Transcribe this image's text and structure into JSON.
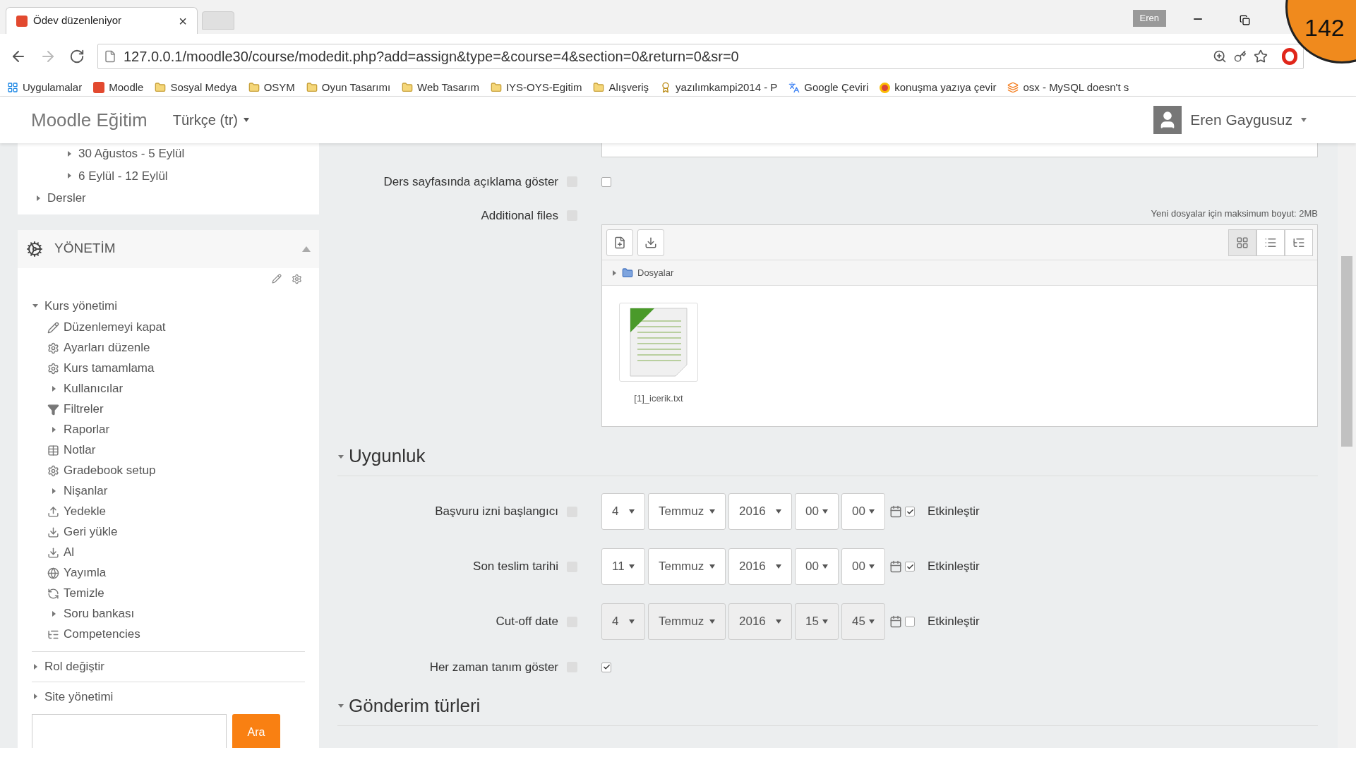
{
  "browser": {
    "tab": {
      "title": "Ödev düzenleniyor",
      "close": "×"
    },
    "profile": "Eren",
    "badge": "142",
    "url": "127.0.0.1/moodle30/course/modedit.php?add=assign&type=&course=4&section=0&return=0&sr=0",
    "bookmarks": [
      {
        "label": "Uygulamalar",
        "kind": "apps"
      },
      {
        "label": "Moodle",
        "kind": "moodle"
      },
      {
        "label": "Sosyal Medya",
        "kind": "folder"
      },
      {
        "label": "OSYM",
        "kind": "folder"
      },
      {
        "label": "Oyun Tasarımı",
        "kind": "folder"
      },
      {
        "label": "Web Tasarım",
        "kind": "folder"
      },
      {
        "label": "IYS-OYS-Egitim",
        "kind": "folder"
      },
      {
        "label": "Alışveriş",
        "kind": "folder"
      },
      {
        "label": "yazılımkampi2014 - P",
        "kind": "badge"
      },
      {
        "label": "Google Çeviri",
        "kind": "translate"
      },
      {
        "label": "konuşma yazıya çevir",
        "kind": "circle"
      },
      {
        "label": "osx - MySQL doesn't s",
        "kind": "stack"
      }
    ]
  },
  "header": {
    "site_name": "Moodle Eğitim",
    "language": "Türkçe (tr)",
    "user": "Eren Gaygusuz"
  },
  "sidebar": {
    "courses": [
      {
        "label": "30 Ağustos - 5 Eylül",
        "expanded": false
      },
      {
        "label": "6 Eylül - 12 Eylül",
        "expanded": false
      }
    ],
    "courses_root": {
      "label": "Dersler",
      "expanded": false
    },
    "admin": {
      "title": "YÖNETİM",
      "tree": [
        {
          "label": "Kurs yönetimi",
          "expanded": true,
          "children": [
            {
              "label": "Düzenlemeyi kapat",
              "kind": "pencil"
            },
            {
              "label": "Ayarları düzenle",
              "kind": "gear"
            },
            {
              "label": "Kurs tamamlama",
              "kind": "gear"
            },
            {
              "label": "Kullanıcılar",
              "kind": "branch"
            },
            {
              "label": "Filtreler",
              "kind": "filter"
            },
            {
              "label": "Raporlar",
              "kind": "branch"
            },
            {
              "label": "Notlar",
              "kind": "table"
            },
            {
              "label": "Gradebook setup",
              "kind": "gear"
            },
            {
              "label": "Nişanlar",
              "kind": "branch"
            },
            {
              "label": "Yedekle",
              "kind": "upload"
            },
            {
              "label": "Geri yükle",
              "kind": "download"
            },
            {
              "label": "Al",
              "kind": "download"
            },
            {
              "label": "Yayımla",
              "kind": "globe"
            },
            {
              "label": "Temizle",
              "kind": "refresh"
            },
            {
              "label": "Soru bankası",
              "kind": "branch"
            },
            {
              "label": "Competencies",
              "kind": "competency"
            }
          ]
        },
        {
          "label": "Rol değiştir",
          "expanded": false
        },
        {
          "label": "Site yönetimi",
          "expanded": false
        }
      ],
      "search_button": "Ara"
    }
  },
  "form": {
    "top_fields": [
      {
        "kind": "checkbox",
        "label": "Ders sayfasında açıklama göster",
        "checked": false
      },
      {
        "kind": "files",
        "label": "Additional files",
        "max_size": "Yeni dosyalar için maksimum boyut: 2MB",
        "folder": "Dosyalar",
        "view_modes": [
          {
            "kind": "grid",
            "selected": true
          },
          {
            "kind": "list",
            "selected": false
          },
          {
            "kind": "tree",
            "selected": false
          }
        ],
        "files": [
          {
            "name": "[1]_icerik.txt"
          }
        ]
      }
    ],
    "sections": [
      {
        "title": "Uygunluk",
        "expanded": true,
        "fields": [
          {
            "kind": "date",
            "label": "Başvuru izni başlangıcı",
            "day": "4",
            "month": "Temmuz",
            "year": "2016",
            "hour": "00",
            "minute": "00",
            "enabled": true,
            "enable_label": "Etkinleştir"
          },
          {
            "kind": "date",
            "label": "Son teslim tarihi",
            "day": "11",
            "month": "Temmuz",
            "year": "2016",
            "hour": "00",
            "minute": "00",
            "enabled": true,
            "enable_label": "Etkinleştir"
          },
          {
            "kind": "date",
            "label": "Cut-off date",
            "day": "4",
            "month": "Temmuz",
            "year": "2016",
            "hour": "15",
            "minute": "45",
            "enabled": false,
            "enable_label": "Etkinleştir"
          },
          {
            "kind": "checkbox",
            "label": "Her zaman tanım göster",
            "checked": true
          }
        ]
      },
      {
        "title": "Gönderim türleri",
        "expanded": true
      }
    ]
  }
}
